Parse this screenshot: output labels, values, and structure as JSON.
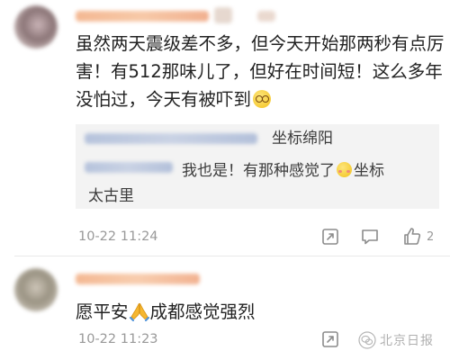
{
  "comments": [
    {
      "text": "虽然两天震级差不多，但今天开始那两秒有点厉害！有512那味儿了，但好在时间短！这么多年没怕过，今天有被吓到",
      "emoji": "dizzy-face-emoji",
      "replies": [
        {
          "text": "坐标绵阳"
        },
        {
          "text": "我也是！有那种感觉了",
          "emoji": "shy-face-emoji",
          "text_after": "坐标",
          "text_line2": "太古里"
        }
      ],
      "time": "10-22 11:24",
      "actions": [
        "share-icon",
        "comment-icon",
        "thumbs-up-icon"
      ],
      "like_count": "2"
    },
    {
      "text_before": "愿平安",
      "emoji": "praying-hands-emoji",
      "text_after": "成都感觉强烈",
      "time": "10-22 11:23",
      "actions": [
        "share-icon"
      ]
    }
  ],
  "watermark": {
    "text": "北京日报"
  }
}
